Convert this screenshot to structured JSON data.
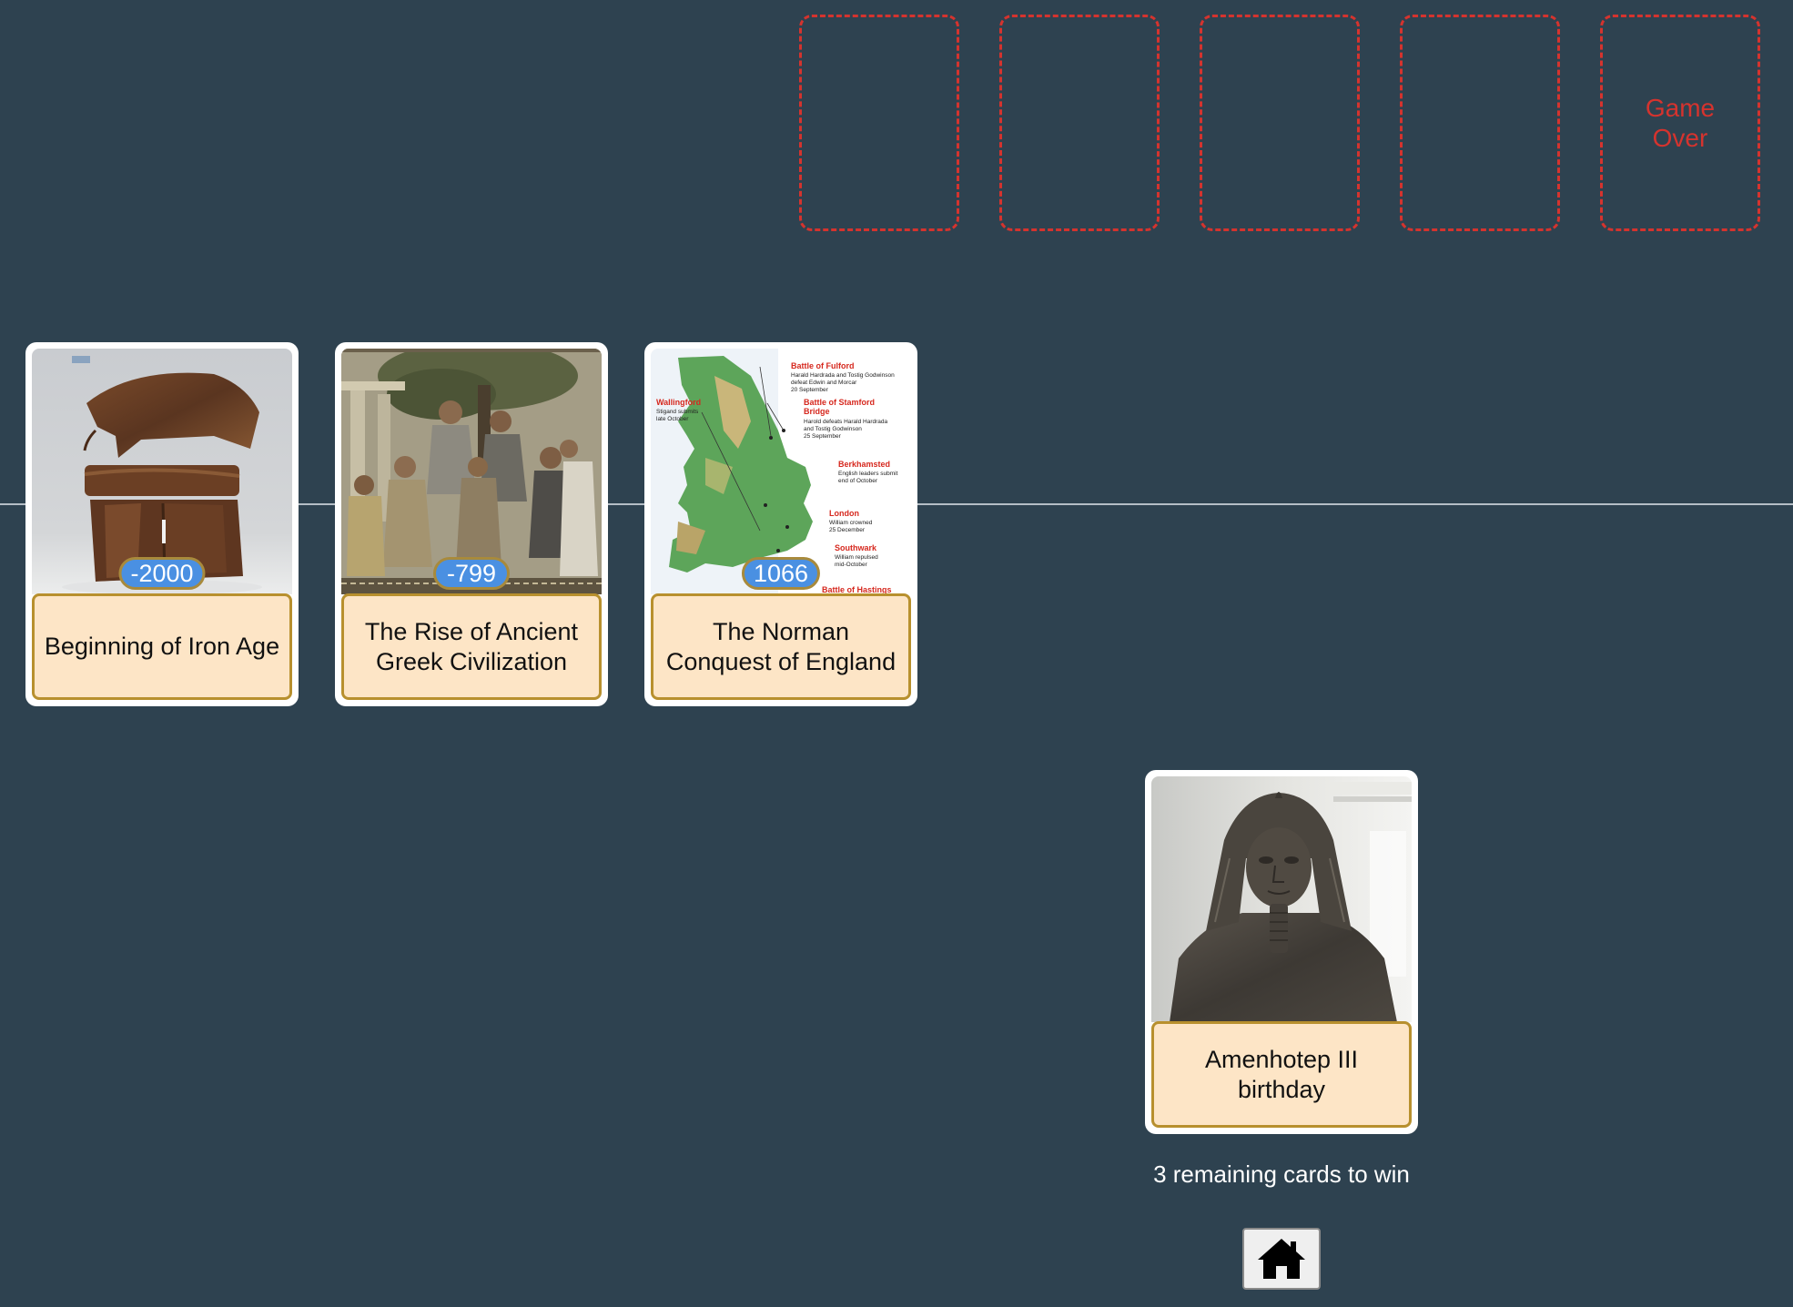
{
  "lives": {
    "slots": [
      "",
      "",
      "",
      ""
    ],
    "game_over_label": "Game Over"
  },
  "timeline": {
    "cards": [
      {
        "year": "-2000",
        "title": "Beginning of Iron Age",
        "image": "rusted iron helmet fragments"
      },
      {
        "year": "-799",
        "title": "The Rise of Ancient Greek Civilization",
        "image": "mosaic of Greek philosophers"
      },
      {
        "year": "1066",
        "title": "The Norman Conquest of England",
        "image": "map of England with battle sites"
      }
    ]
  },
  "map_labels": {
    "fulford": "Battle of Fulford",
    "fulford_note": "Harald Hardrada and Tostig Godwinson",
    "fulford_note2": "defeat Edwin and Morcar",
    "fulford_date": "20 September",
    "wallingford": "Wallingford",
    "wallingford_note": "Stigand submits",
    "wallingford_note2": "late October",
    "stamford": "Battle of Stamford",
    "stamford2": "Bridge",
    "stamford_note": "Harold defeats Harald Hardrada",
    "stamford_note2": "and Tostig Godwinson",
    "stamford_date": "25 September",
    "berkhamsted": "Berkhamsted",
    "berkhamsted_note": "English leaders submit",
    "berkhamsted_note2": "end of October",
    "london": "London",
    "london_note": "William crowned",
    "london_date": "25 December",
    "southwark": "Southwark",
    "southwark_note": "William repulsed",
    "southwark_note2": "mid-October",
    "hastings": "Battle of Hastings"
  },
  "current_card": {
    "title": "Amenhotep III birthday",
    "image": "Egyptian pharaoh statue"
  },
  "status": {
    "remaining_text": "3 remaining cards to win"
  },
  "colors": {
    "background": "#2e4250",
    "slot_border": "#d5332e",
    "card_title_bg": "#fde5c6",
    "year_badge": "#4a90e2"
  },
  "icons": {
    "home": "home-icon"
  }
}
